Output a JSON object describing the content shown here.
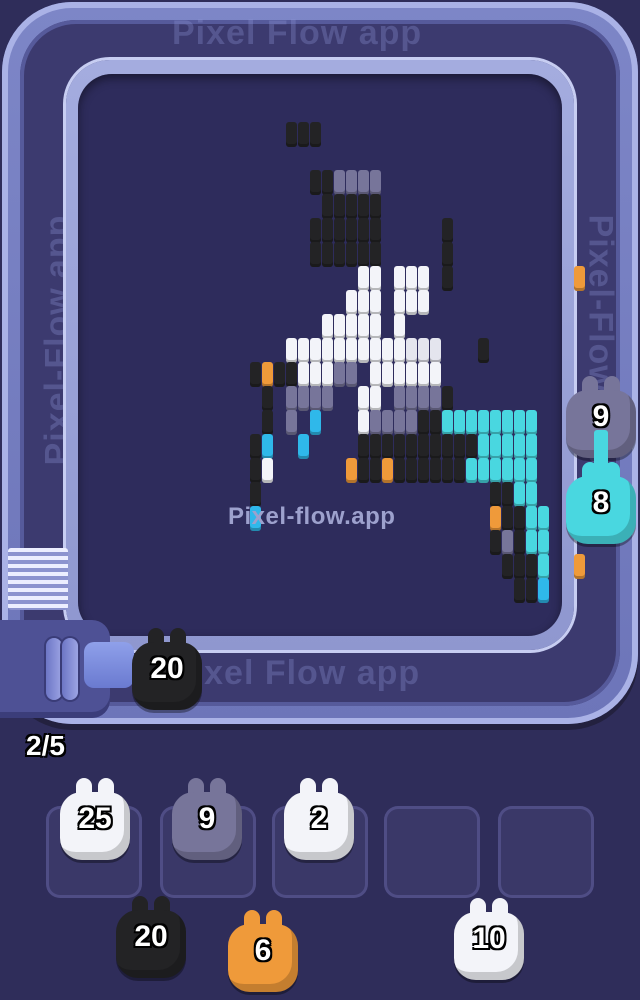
{
  "watermarks": {
    "center": "Pixel-flow.app",
    "track_top": "Pixel Flow app",
    "track_bottom": "Pixel Flow app",
    "track_left": "Pixel-Flow.app",
    "track_right": "Pixel-Flow.app"
  },
  "colors": {
    "white": "#f3f4f9",
    "light": "#e4e5ee",
    "gray": "#77759a",
    "black": "#232325",
    "orange": "#ef9a3a",
    "cyan": "#49d7e0",
    "blue": "#2fb8ea"
  },
  "level_progress": "2/5",
  "track_units": [
    {
      "count": "9",
      "color": "gray"
    },
    {
      "count": "8",
      "color": "cyan"
    }
  ],
  "launcher_unit": {
    "count": "20",
    "color": "black"
  },
  "slots": [
    {
      "count": "25",
      "color": "white"
    },
    {
      "count": "9",
      "color": "gray"
    },
    {
      "count": "2",
      "color": "white"
    },
    {
      "count": "",
      "color": ""
    },
    {
      "count": "",
      "color": ""
    }
  ],
  "queue": [
    {
      "count": "20",
      "color": "black"
    },
    {
      "count": "6",
      "color": "orange"
    },
    {
      "count": "10",
      "color": "white"
    }
  ],
  "pixel_art": {
    "blocks": [
      {
        "col": 10,
        "row": 0,
        "w": 3,
        "h": 1,
        "color": "black"
      },
      {
        "col": 12,
        "row": 2,
        "w": 2,
        "h": 1,
        "color": "black"
      },
      {
        "col": 14,
        "row": 2,
        "w": 4,
        "h": 1,
        "color": "gray"
      },
      {
        "col": 13,
        "row": 3,
        "w": 5,
        "h": 1,
        "color": "black"
      },
      {
        "col": 12,
        "row": 4,
        "w": 6,
        "h": 2,
        "color": "black"
      },
      {
        "col": 23,
        "row": 4,
        "w": 1,
        "h": 3,
        "color": "black"
      },
      {
        "col": 16,
        "row": 6,
        "w": 2,
        "h": 1,
        "color": "white"
      },
      {
        "col": 19,
        "row": 6,
        "w": 3,
        "h": 1,
        "color": "white"
      },
      {
        "col": 15,
        "row": 7,
        "w": 3,
        "h": 1,
        "color": "white"
      },
      {
        "col": 19,
        "row": 7,
        "w": 3,
        "h": 1,
        "color": "white"
      },
      {
        "col": 13,
        "row": 8,
        "w": 4,
        "h": 1,
        "color": "white"
      },
      {
        "col": 17,
        "row": 8,
        "w": 1,
        "h": 1,
        "color": "white"
      },
      {
        "col": 19,
        "row": 8,
        "w": 1,
        "h": 1,
        "color": "white"
      },
      {
        "col": 10,
        "row": 9,
        "w": 10,
        "h": 1,
        "color": "white"
      },
      {
        "col": 20,
        "row": 9,
        "w": 3,
        "h": 1,
        "color": "light"
      },
      {
        "col": 7,
        "row": 10,
        "w": 1,
        "h": 1,
        "color": "black"
      },
      {
        "col": 8,
        "row": 10,
        "w": 1,
        "h": 1,
        "color": "orange"
      },
      {
        "col": 9,
        "row": 10,
        "w": 2,
        "h": 1,
        "color": "black"
      },
      {
        "col": 11,
        "row": 10,
        "w": 3,
        "h": 1,
        "color": "white"
      },
      {
        "col": 14,
        "row": 10,
        "w": 2,
        "h": 1,
        "color": "gray"
      },
      {
        "col": 17,
        "row": 10,
        "w": 6,
        "h": 1,
        "color": "white"
      },
      {
        "col": 8,
        "row": 11,
        "w": 1,
        "h": 1,
        "color": "black"
      },
      {
        "col": 10,
        "row": 11,
        "w": 4,
        "h": 1,
        "color": "gray"
      },
      {
        "col": 16,
        "row": 11,
        "w": 2,
        "h": 1,
        "color": "white"
      },
      {
        "col": 19,
        "row": 11,
        "w": 4,
        "h": 1,
        "color": "gray"
      },
      {
        "col": 23,
        "row": 11,
        "w": 1,
        "h": 1,
        "color": "black"
      },
      {
        "col": 8,
        "row": 12,
        "w": 1,
        "h": 1,
        "color": "black"
      },
      {
        "col": 10,
        "row": 12,
        "w": 1,
        "h": 1,
        "color": "gray"
      },
      {
        "col": 12,
        "row": 12,
        "w": 1,
        "h": 1,
        "color": "blue"
      },
      {
        "col": 16,
        "row": 12,
        "w": 1,
        "h": 1,
        "color": "white"
      },
      {
        "col": 17,
        "row": 12,
        "w": 4,
        "h": 1,
        "color": "gray"
      },
      {
        "col": 21,
        "row": 12,
        "w": 2,
        "h": 1,
        "color": "black"
      },
      {
        "col": 23,
        "row": 12,
        "w": 3,
        "h": 1,
        "color": "cyan"
      },
      {
        "col": 26,
        "row": 12,
        "w": 5,
        "h": 1,
        "color": "cyan"
      },
      {
        "col": 7,
        "row": 13,
        "w": 1,
        "h": 1,
        "color": "black"
      },
      {
        "col": 8,
        "row": 13,
        "w": 1,
        "h": 1,
        "color": "blue"
      },
      {
        "col": 11,
        "row": 13,
        "w": 1,
        "h": 1,
        "color": "blue"
      },
      {
        "col": 16,
        "row": 13,
        "w": 10,
        "h": 1,
        "color": "black"
      },
      {
        "col": 26,
        "row": 13,
        "w": 5,
        "h": 1,
        "color": "cyan"
      },
      {
        "col": 7,
        "row": 14,
        "w": 1,
        "h": 1,
        "color": "black"
      },
      {
        "col": 8,
        "row": 14,
        "w": 1,
        "h": 1,
        "color": "white"
      },
      {
        "col": 15,
        "row": 14,
        "w": 1,
        "h": 1,
        "color": "orange"
      },
      {
        "col": 16,
        "row": 14,
        "w": 2,
        "h": 1,
        "color": "black"
      },
      {
        "col": 18,
        "row": 14,
        "w": 1,
        "h": 1,
        "color": "orange"
      },
      {
        "col": 19,
        "row": 14,
        "w": 6,
        "h": 1,
        "color": "black"
      },
      {
        "col": 25,
        "row": 14,
        "w": 6,
        "h": 1,
        "color": "cyan"
      },
      {
        "col": 7,
        "row": 15,
        "w": 1,
        "h": 1,
        "color": "black"
      },
      {
        "col": 27,
        "row": 15,
        "w": 2,
        "h": 1,
        "color": "black"
      },
      {
        "col": 29,
        "row": 15,
        "w": 2,
        "h": 1,
        "color": "cyan"
      },
      {
        "col": 7,
        "row": 16,
        "w": 1,
        "h": 1,
        "color": "blue"
      },
      {
        "col": 27,
        "row": 16,
        "w": 1,
        "h": 1,
        "color": "orange"
      },
      {
        "col": 28,
        "row": 16,
        "w": 2,
        "h": 1,
        "color": "black"
      },
      {
        "col": 30,
        "row": 16,
        "w": 2,
        "h": 1,
        "color": "cyan"
      },
      {
        "col": 27,
        "row": 17,
        "w": 1,
        "h": 1,
        "color": "black"
      },
      {
        "col": 28,
        "row": 17,
        "w": 1,
        "h": 1,
        "color": "gray"
      },
      {
        "col": 29,
        "row": 17,
        "w": 1,
        "h": 1,
        "color": "black"
      },
      {
        "col": 30,
        "row": 17,
        "w": 2,
        "h": 1,
        "color": "cyan"
      },
      {
        "col": 28,
        "row": 18,
        "w": 3,
        "h": 1,
        "color": "black"
      },
      {
        "col": 31,
        "row": 18,
        "w": 1,
        "h": 1,
        "color": "cyan"
      },
      {
        "col": 29,
        "row": 19,
        "w": 2,
        "h": 1,
        "color": "black"
      },
      {
        "col": 31,
        "row": 19,
        "w": 1,
        "h": 1,
        "color": "blue"
      },
      {
        "col": 34,
        "row": 6,
        "w": 1,
        "h": 1,
        "color": "orange"
      },
      {
        "col": 26,
        "row": 9,
        "w": 1,
        "h": 1,
        "color": "black"
      },
      {
        "col": 34,
        "row": 18,
        "w": 1,
        "h": 1,
        "color": "orange"
      }
    ]
  }
}
